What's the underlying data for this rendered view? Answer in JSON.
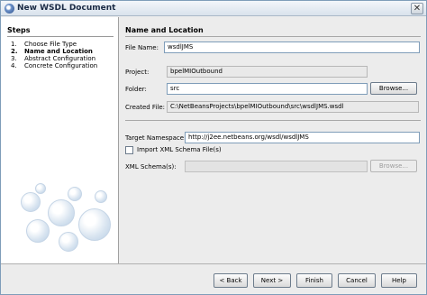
{
  "window": {
    "title": "New WSDL Document"
  },
  "steps": {
    "title": "Steps",
    "items": [
      {
        "num": "1.",
        "label": "Choose File Type"
      },
      {
        "num": "2.",
        "label": "Name and Location"
      },
      {
        "num": "3.",
        "label": "Abstract Configuration"
      },
      {
        "num": "4.",
        "label": "Concrete Configuration"
      }
    ]
  },
  "main": {
    "section_title": "Name and Location",
    "file_name": {
      "label": "File Name:",
      "value": "wsdlJMS"
    },
    "project": {
      "label": "Project:",
      "value": "bpelMIOutbound"
    },
    "folder": {
      "label": "Folder:",
      "value": "src",
      "browse_label": "Browse..."
    },
    "created_file": {
      "label": "Created File:",
      "value": "C:\\NetBeansProjects\\bpelMIOutbound\\src\\wsdlJMS.wsdl"
    },
    "target_namespace": {
      "label": "Target Namespace:",
      "value": "http://j2ee.netbeans.org/wsdl/wsdlJMS"
    },
    "import_schema": {
      "label": "Import XML Schema File(s)",
      "checked": false
    },
    "xml_schemas": {
      "label": "XML Schema(s):",
      "value": "",
      "browse_label": "Browse..."
    }
  },
  "footer": {
    "back_label": "< Back",
    "next_label": "Next >",
    "finish_label": "Finish",
    "cancel_label": "Cancel",
    "help_label": "Help"
  }
}
